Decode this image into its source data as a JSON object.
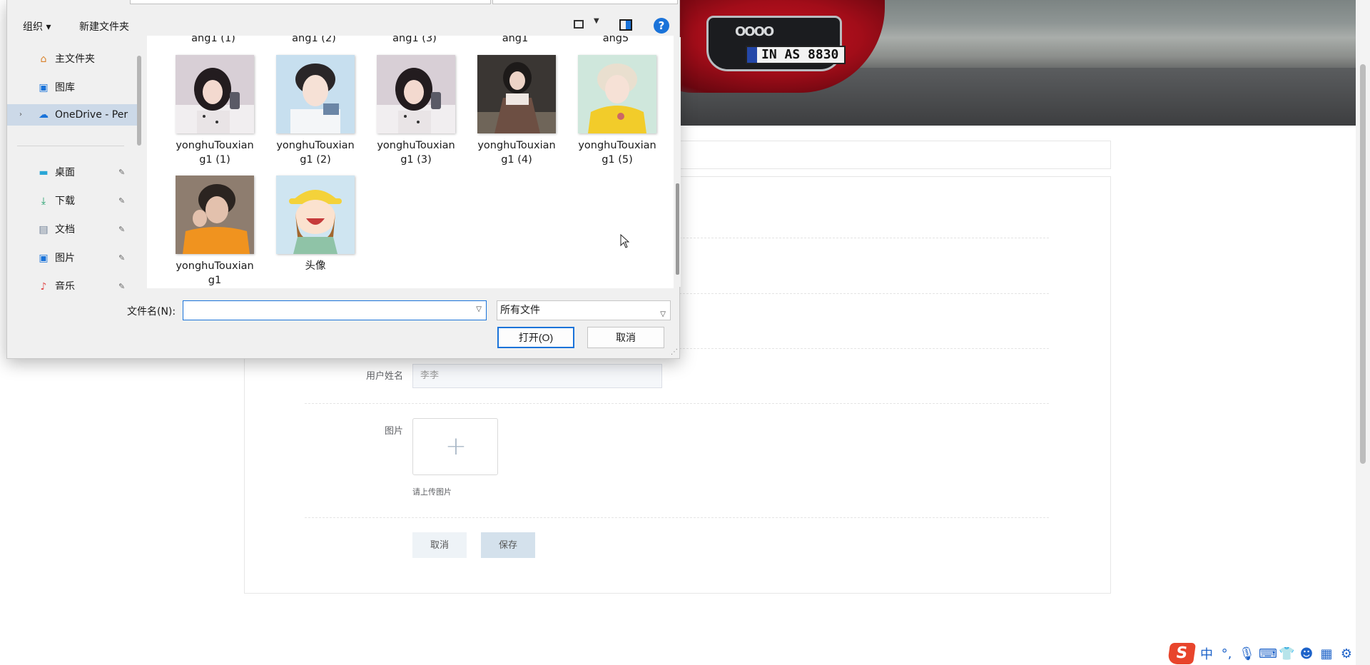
{
  "dialog": {
    "toolbar": {
      "organize": "组织 ▾",
      "new_folder": "新建文件夹",
      "help": "?"
    },
    "nav": [
      {
        "label": "主文件夹",
        "icon": "home-icon"
      },
      {
        "label": "图库",
        "icon": "gallery-icon"
      },
      {
        "label": "OneDrive - Per",
        "icon": "onedrive-icon"
      },
      {
        "label": "桌面",
        "icon": "desktop-icon"
      },
      {
        "label": "下载",
        "icon": "download-icon"
      },
      {
        "label": "文档",
        "icon": "document-icon"
      },
      {
        "label": "图片",
        "icon": "pictures-icon"
      },
      {
        "label": "音乐",
        "icon": "music-icon"
      }
    ],
    "cut_row": [
      "ang1 (1)",
      "ang1 (2)",
      "ang1 (3)",
      "ang1",
      "ang5"
    ],
    "files": [
      {
        "name_l1": "yonghuTouxian",
        "name_l2": "g1 (1)"
      },
      {
        "name_l1": "yonghuTouxian",
        "name_l2": "g1 (2)"
      },
      {
        "name_l1": "yonghuTouxian",
        "name_l2": "g1 (3)"
      },
      {
        "name_l1": "yonghuTouxian",
        "name_l2": "g1 (4)"
      },
      {
        "name_l1": "yonghuTouxian",
        "name_l2": "g1 (5)"
      },
      {
        "name_l1": "yonghuTouxian",
        "name_l2": "g1"
      },
      {
        "name_l1": "头像",
        "name_l2": ""
      }
    ],
    "filename_label": "文件名(N):",
    "filename_value": "",
    "filetype": "所有文件",
    "open_label": "打开(O)",
    "cancel_label": "取消"
  },
  "form": {
    "username_label": "用户姓名",
    "username_value": "李李",
    "image_label": "图片",
    "upload_plus": "+",
    "upload_hint": "请上传图片",
    "cancel_label": "取消",
    "save_label": "保存"
  },
  "banner": {
    "plate": "IN AS 8830",
    "rings": "OOOO"
  },
  "ime": {
    "logo": "S",
    "mode": "中"
  }
}
